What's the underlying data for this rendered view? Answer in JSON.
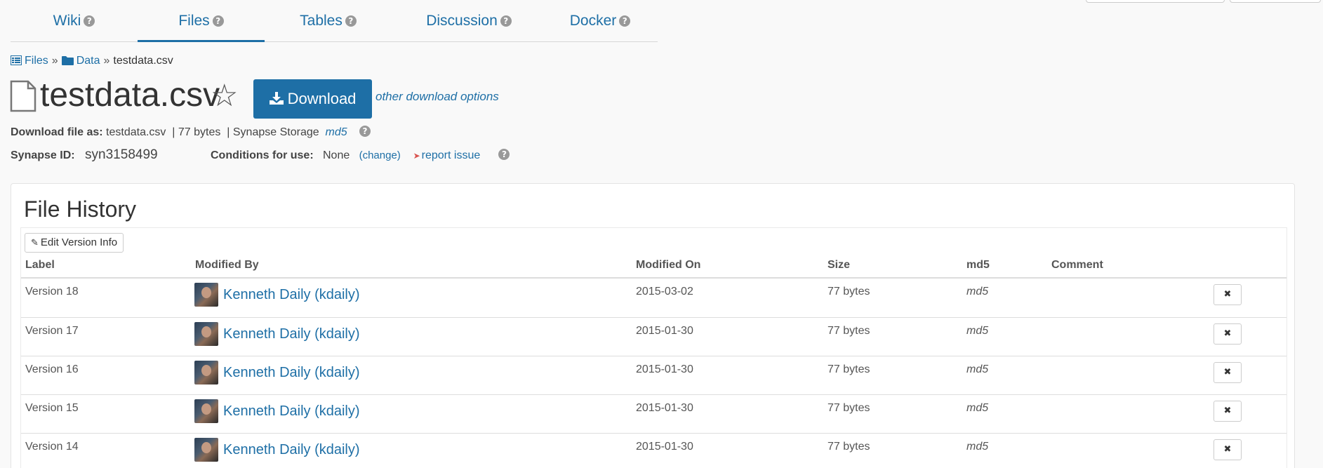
{
  "tabs": [
    {
      "label": "Wiki"
    },
    {
      "label": "Files"
    },
    {
      "label": "Tables"
    },
    {
      "label": "Discussion"
    },
    {
      "label": "Docker"
    }
  ],
  "help_glyph": "?",
  "breadcrumb": {
    "files": "Files",
    "sep": "»",
    "data": "Data",
    "current": "testdata.csv"
  },
  "file": {
    "title": "testdata.csv",
    "download_label": "Download",
    "other_download": "other download options",
    "download_as_label": "Download file as:",
    "download_as_value": "testdata.csv",
    "size": "| 77 bytes",
    "storage": "| Synapse Storage",
    "md5": "md5",
    "synapse_id_label": "Synapse ID:",
    "synapse_id": "syn3158499",
    "conditions_label": "Conditions for use:",
    "conditions_value": "None",
    "change": "(change)",
    "report_issue": "report issue"
  },
  "history": {
    "title": "File History",
    "edit_button": "Edit Version Info",
    "columns": {
      "label": "Label",
      "modified_by": "Modified By",
      "modified_on": "Modified On",
      "size": "Size",
      "md5": "md5",
      "comment": "Comment"
    },
    "rows": [
      {
        "label": "Version 18",
        "user": "Kenneth Daily (kdaily)",
        "date": "2015-03-02",
        "size": "77 bytes",
        "md5": "md5"
      },
      {
        "label": "Version 17",
        "user": "Kenneth Daily (kdaily)",
        "date": "2015-01-30",
        "size": "77 bytes",
        "md5": "md5"
      },
      {
        "label": "Version 16",
        "user": "Kenneth Daily (kdaily)",
        "date": "2015-01-30",
        "size": "77 bytes",
        "md5": "md5"
      },
      {
        "label": "Version 15",
        "user": "Kenneth Daily (kdaily)",
        "date": "2015-01-30",
        "size": "77 bytes",
        "md5": "md5"
      },
      {
        "label": "Version 14",
        "user": "Kenneth Daily (kdaily)",
        "date": "2015-01-30",
        "size": "77 bytes",
        "md5": "md5"
      }
    ],
    "delete_glyph": "✖"
  },
  "colors": {
    "accent": "#1e6fa6",
    "report_icon": "#d9534f"
  }
}
